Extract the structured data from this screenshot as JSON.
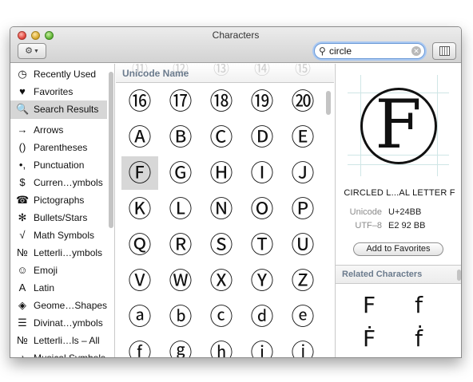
{
  "window": {
    "title": "Characters"
  },
  "toolbar": {
    "gear_icon": "gear-icon",
    "search": {
      "value": "circle",
      "placeholder": ""
    },
    "clear_icon": "clear-icon",
    "palette_icon": "keyboard-palette-icon"
  },
  "sidebar": {
    "items": [
      {
        "icon": "◷",
        "icon_name": "clock-icon",
        "label": "Recently Used"
      },
      {
        "icon": "♥",
        "icon_name": "heart-icon",
        "label": "Favorites"
      },
      {
        "icon": "🔍",
        "icon_name": "search-icon",
        "label": "Search Results",
        "selected": true
      },
      {
        "icon": "→",
        "icon_name": "arrow-icon",
        "label": "Arrows"
      },
      {
        "icon": "()",
        "icon_name": "parentheses-icon",
        "label": "Parentheses"
      },
      {
        "icon": "•,",
        "icon_name": "punctuation-icon",
        "label": "Punctuation"
      },
      {
        "icon": "$",
        "icon_name": "dollar-icon",
        "label": "Curren…ymbols"
      },
      {
        "icon": "☎",
        "icon_name": "telephone-icon",
        "label": "Pictographs"
      },
      {
        "icon": "✻",
        "icon_name": "asterisk-icon",
        "label": "Bullets/Stars"
      },
      {
        "icon": "√",
        "icon_name": "square-root-icon",
        "label": "Math Symbols"
      },
      {
        "icon": "№",
        "icon_name": "numero-icon",
        "label": "Letterli…ymbols"
      },
      {
        "icon": "☺",
        "icon_name": "smiley-icon",
        "label": "Emoji"
      },
      {
        "icon": "A",
        "icon_name": "latin-a-icon",
        "label": "Latin"
      },
      {
        "icon": "◈",
        "icon_name": "geometric-shape-icon",
        "label": "Geome…Shapes"
      },
      {
        "icon": "☰",
        "icon_name": "trigram-icon",
        "label": "Divinat…ymbols"
      },
      {
        "icon": "№",
        "icon_name": "numero-icon",
        "label": "Letterli…ls – All"
      },
      {
        "icon": "♪",
        "icon_name": "music-note-icon",
        "label": "Musical Symbols"
      }
    ]
  },
  "grid": {
    "header": "Unicode Name",
    "ghost_row": [
      "⑪",
      "⑫",
      "⑬",
      "⑭",
      "⑮"
    ],
    "rows": [
      [
        "⑯",
        "⑰",
        "⑱",
        "⑲",
        "⑳"
      ],
      [
        "Ⓐ",
        "Ⓑ",
        "Ⓒ",
        "Ⓓ",
        "Ⓔ"
      ],
      [
        "Ⓕ",
        "Ⓖ",
        "Ⓗ",
        "Ⓘ",
        "Ⓙ"
      ],
      [
        "Ⓚ",
        "Ⓛ",
        "Ⓝ",
        "Ⓞ",
        "Ⓟ"
      ],
      [
        "Ⓠ",
        "Ⓡ",
        "Ⓢ",
        "Ⓣ",
        "Ⓤ"
      ],
      [
        "Ⓥ",
        "Ⓦ",
        "Ⓧ",
        "Ⓨ",
        "Ⓩ"
      ],
      [
        "ⓐ",
        "ⓑ",
        "ⓒ",
        "ⓓ",
        "ⓔ"
      ],
      [
        "ⓕ",
        "ⓖ",
        "ⓗ",
        "ⓘ",
        "ⓙ"
      ]
    ],
    "selected_char": "Ⓕ"
  },
  "detail": {
    "preview_letter": "F",
    "name": "CIRCLED L...AL LETTER F",
    "unicode_label": "Unicode",
    "unicode_value": "U+24BB",
    "utf8_label": "UTF–8",
    "utf8_value": "E2 92 BB",
    "favorites_button": "Add to Favorites",
    "related_header": "Related Characters",
    "related": [
      "F",
      "f",
      "Ḟ",
      "ḟ"
    ]
  }
}
